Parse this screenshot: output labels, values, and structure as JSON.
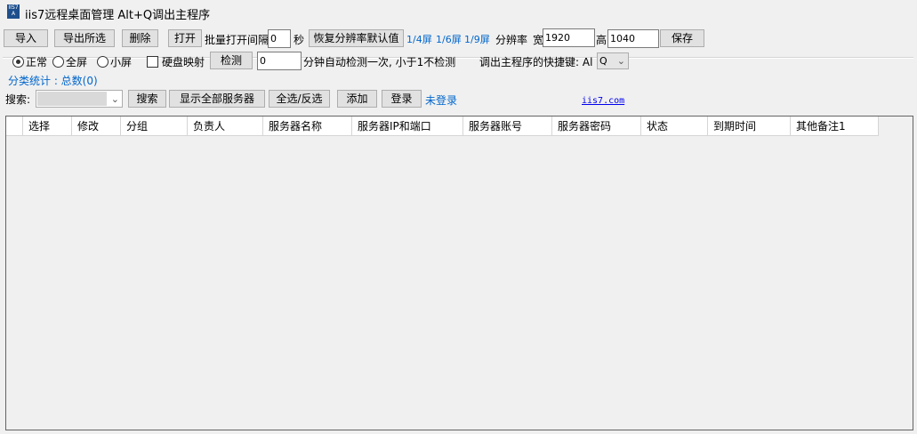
{
  "title": "iis7远程桌面管理 Alt+Q调出主程序",
  "toolbar": {
    "import": "导入",
    "export": "导出所选",
    "delete": "删除",
    "open": "打开",
    "interval_label": "批量打开间隔",
    "interval_value": "0",
    "seconds": "秒",
    "restore": "恢复分辨率默认值",
    "quarter": "1/4屏",
    "sixth": "1/6屏",
    "ninth": "1/9屏",
    "resolution": "分辨率",
    "width_label": "宽",
    "width_value": "1920",
    "height_label": "高",
    "height_value": "1040",
    "save": "保存"
  },
  "row2": {
    "normal": "正常",
    "full": "全屏",
    "small": "小屏",
    "disk": "硬盘映射",
    "check": "检测",
    "minutes_value": "0",
    "minutes_label": "分钟自动检测一次, 小于1不检测",
    "hotkey_label": "调出主程序的快捷键: Al",
    "hotkey_value": "Q"
  },
  "stats": "分类统计 : 总数(0)",
  "search": {
    "label": "搜索:",
    "search": "搜索",
    "show_all": "显示全部服务器",
    "select_all": "全选/反选",
    "add": "添加",
    "login": "登录",
    "status": "未登录",
    "site": "iis7.com"
  },
  "columns": [
    "选择",
    "修改",
    "分组",
    "负责人",
    "服务器名称",
    "服务器IP和端口",
    "服务器账号",
    "服务器密码",
    "状态",
    "到期时间",
    "其他备注1"
  ]
}
